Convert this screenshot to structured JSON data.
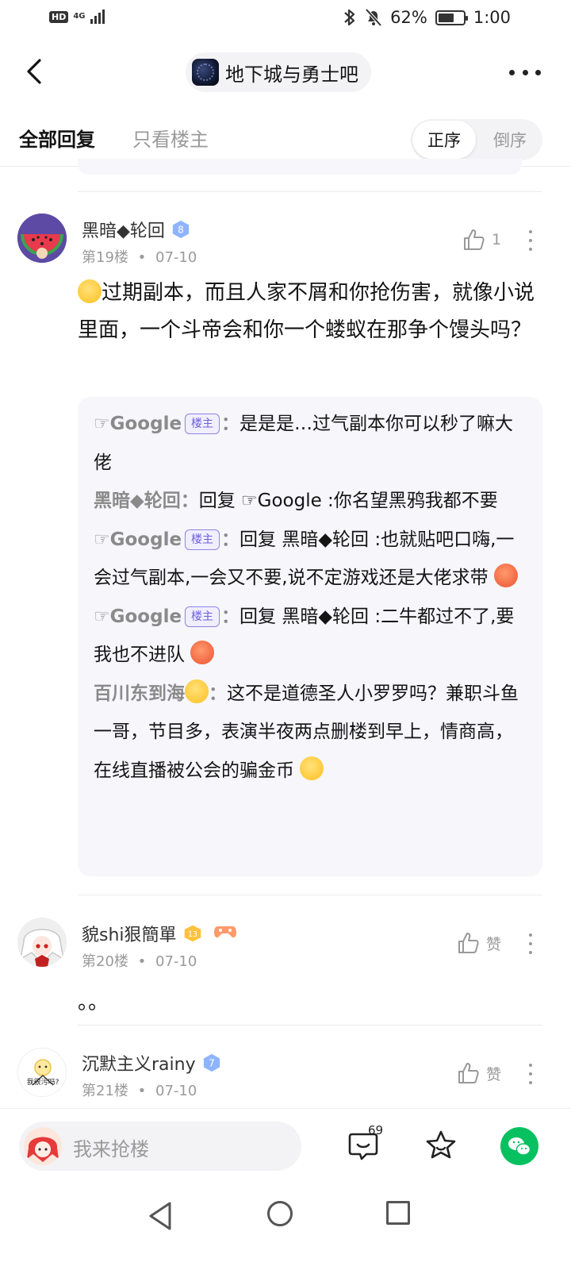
{
  "status_bar": {
    "hd": "HD",
    "network": "4G",
    "battery": "62%",
    "battery_level": 0.62,
    "time": "1:00"
  },
  "nav": {
    "forum_name": "地下城与勇士吧"
  },
  "tabs": {
    "all": "全部回复",
    "op_only": "只看楼主",
    "asc": "正序",
    "desc": "倒序"
  },
  "posts": [
    {
      "author": "黑暗◆轮回",
      "level": "8",
      "floor": "第19楼",
      "date": "07-10",
      "likes": "1",
      "content": "过期副本，而且人家不屑和你抢伤害，就像小说里面，一个斗帝会和你一个蝼蚁在那争个馒头吗？",
      "replies": [
        {
          "name": "☞Google",
          "op": true,
          "text": "是是是…过气副本你可以秒了嘛大佬"
        },
        {
          "name": "黑暗◆轮回",
          "op": false,
          "text": "回复 ☞Google :你名望黑鸦我都不要"
        },
        {
          "name": "☞Google",
          "op": true,
          "text": "回复 黑暗◆轮回 :也就贴吧口嗨,一会过气副本,一会又不要,说不定游戏还是大佬求带"
        },
        {
          "name": "☞Google",
          "op": true,
          "text": "回复 黑暗◆轮回 :二牛都过不了,要我也不进队"
        },
        {
          "name": "百川东到海",
          "op": false,
          "text": "这不是道德圣人小罗罗吗？兼职斗鱼一哥，节目多，表演半夜两点删楼到早上，情商高，在线直播被公会的骗金币"
        }
      ]
    },
    {
      "author": "貌shi狠簡單",
      "level": "13",
      "floor": "第20楼",
      "date": "07-10",
      "likes": "赞",
      "content": "。。"
    },
    {
      "author": "沉默主义rainy",
      "level": "7",
      "floor": "第21楼",
      "date": "07-10",
      "likes": "赞",
      "avatar_text": "我很污吗?"
    }
  ],
  "op_tag": "楼主",
  "separator": "•",
  "reply_colon": "：",
  "bottom_bar": {
    "placeholder": "我来抢楼",
    "comment_count": "69"
  },
  "colors": {
    "accent_purple": "#6d5fde",
    "wechat_green": "#07c160",
    "level_blue": "#8fb4ff",
    "level_gold": "#ffc23a"
  }
}
